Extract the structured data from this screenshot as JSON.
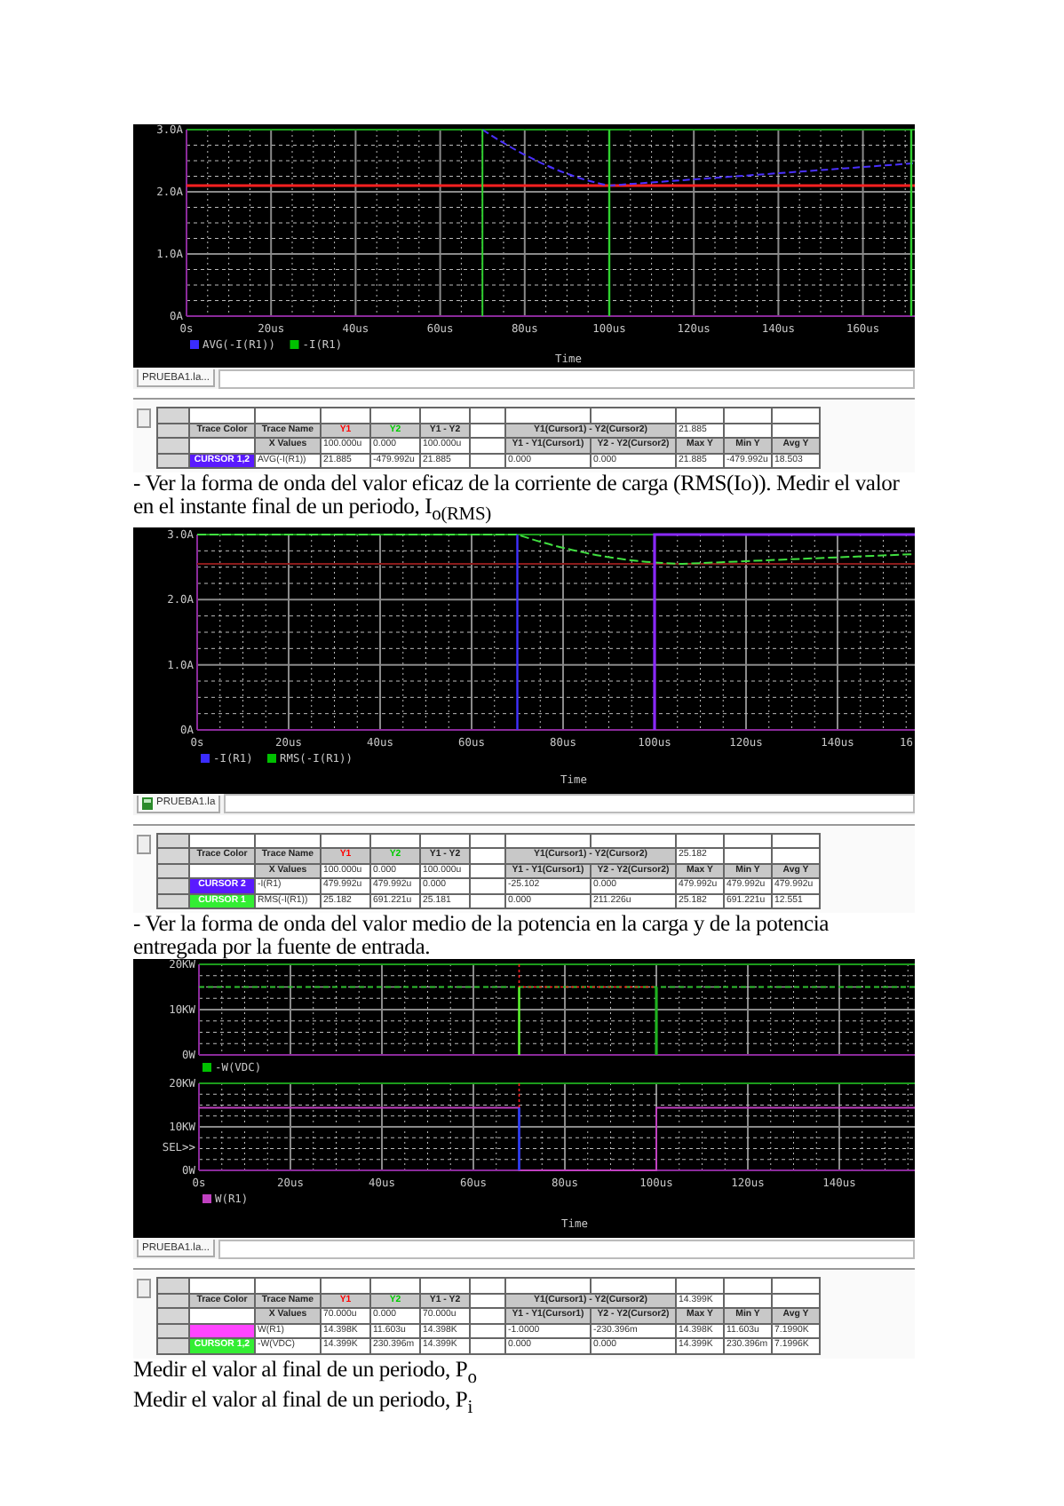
{
  "sections": [
    {
      "plot": {
        "panels": [
          {
            "yticks": [
              "3.0A",
              "2.0A",
              "1.0A",
              "0A"
            ],
            "legend": [
              {
                "label": "AVG(-I(R1))",
                "color": "#3a2cff"
              },
              {
                "label": "-I(R1)",
                "color": "#00c000"
              }
            ]
          }
        ],
        "xticks": [
          "0s",
          "20us",
          "40us",
          "60us",
          "80us",
          "100us",
          "120us",
          "140us",
          "160us"
        ],
        "xlabel": "Time"
      },
      "probe": {
        "tab": "PRUEBA1.la...",
        "has_icon": false,
        "table": {
          "columns": [
            {
              "label": "Trace Color"
            },
            {
              "label": "Trace Name"
            },
            {
              "label": "Y1",
              "color": "#ff0000"
            },
            {
              "label": "Y2",
              "color": "#00cc00"
            },
            {
              "label": "Y1 - Y2"
            }
          ],
          "cursor_delta_label": "Y1(Cursor1) - Y2(Cursor2)",
          "cursor_delta": "21.885",
          "x_values": {
            "label": "X Values",
            "values": [
              "100.000u",
              "0.000",
              "100.000u"
            ]
          },
          "stat_columns": [
            "Y1 - Y1(Cursor1)",
            "Y2 - Y2(Cursor2)",
            "Max Y",
            "Min Y",
            "Avg Y"
          ],
          "rows": [
            {
              "cursor": "CURSOR 1,2",
              "color": "#5a1aff",
              "name": "AVG(-I(R1))",
              "values": [
                "21.885",
                "-479.992u",
                "21.885"
              ],
              "stats": [
                "0.000",
                "0.000",
                "21.885",
                "-479.992u",
                "18.503"
              ]
            }
          ]
        }
      },
      "paragraph": "- Ver la forma de onda del valor eficaz de la corriente de carga (RMS(Io)). Medir el valor en el instante final de un periodo, I$_{o(RMS)}$"
    },
    {
      "plot": {
        "panels": [
          {
            "yticks": [
              "3.0A",
              "2.0A",
              "1.0A",
              "0A"
            ],
            "legend": [
              {
                "label": "-I(R1)",
                "color": "#3a2cff"
              },
              {
                "label": "RMS(-I(R1))",
                "color": "#00c000"
              }
            ]
          }
        ],
        "xticks": [
          "0s",
          "20us",
          "40us",
          "60us",
          "80us",
          "100us",
          "120us",
          "140us",
          "16"
        ],
        "xlabel": "Time"
      },
      "probe": {
        "tab": "PRUEBA1.la",
        "has_icon": true,
        "table": {
          "columns": [
            {
              "label": "Trace Color"
            },
            {
              "label": "Trace Name"
            },
            {
              "label": "Y1",
              "color": "#ff0000"
            },
            {
              "label": "Y2",
              "color": "#00cc00"
            },
            {
              "label": "Y1 - Y2"
            }
          ],
          "cursor_delta_label": "Y1(Cursor1) - Y2(Cursor2)",
          "cursor_delta": "25.182",
          "x_values": {
            "label": "X Values",
            "values": [
              "100.000u",
              "0.000",
              "100.000u"
            ]
          },
          "stat_columns": [
            "Y1 - Y1(Cursor1)",
            "Y2 - Y2(Cursor2)",
            "Max Y",
            "Min Y",
            "Avg Y"
          ],
          "rows": [
            {
              "cursor": "CURSOR 2",
              "color": "#5a1aff",
              "name": "-I(R1)",
              "values": [
                "479.992u",
                "479.992u",
                "0.000"
              ],
              "stats": [
                "-25.102",
                "0.000",
                "479.992u",
                "479.992u",
                "479.992u"
              ]
            },
            {
              "cursor": "CURSOR 1",
              "color": "#33ee33",
              "name": "RMS(-I(R1))",
              "values": [
                "25.182",
                "691.221u",
                "25.181"
              ],
              "stats": [
                "0.000",
                "211.226u",
                "25.182",
                "691.221u",
                "12.551"
              ]
            }
          ]
        }
      },
      "paragraph": "- Ver la forma de onda del valor medio de la potencia en la carga y de la potencia entregada por la fuente de entrada."
    },
    {
      "plot": {
        "panels": [
          {
            "yticks": [
              "20KW",
              "10KW",
              "0W"
            ],
            "legend": [
              {
                "label": "-W(VDC)",
                "color": "#00c000"
              }
            ]
          },
          {
            "yticks": [
              "20KW",
              "10KW",
              "0W"
            ],
            "side_label": "SEL>>",
            "legend": [
              {
                "label": "W(R1)",
                "color": "#c040c0"
              }
            ]
          }
        ],
        "xticks": [
          "0s",
          "20us",
          "40us",
          "60us",
          "80us",
          "100us",
          "120us",
          "140us"
        ],
        "xlabel": "Time"
      },
      "probe": {
        "tab": "PRUEBA1.la...",
        "has_icon": false,
        "table": {
          "columns": [
            {
              "label": "Trace Color"
            },
            {
              "label": "Trace Name"
            },
            {
              "label": "Y1",
              "color": "#ff0000"
            },
            {
              "label": "Y2",
              "color": "#00cc00"
            },
            {
              "label": "Y1 - Y2"
            }
          ],
          "cursor_delta_label": "Y1(Cursor1) - Y2(Cursor2)",
          "cursor_delta": "14.399K",
          "x_values": {
            "label": "X Values",
            "values": [
              "70.000u",
              "0.000",
              "70.000u"
            ]
          },
          "stat_columns": [
            "Y1 - Y1(Cursor1)",
            "Y2 - Y2(Cursor2)",
            "Max Y",
            "Min Y",
            "Avg Y"
          ],
          "rows": [
            {
              "color": "#ff44ff",
              "name": "W(R1)",
              "values": [
                "14.398K",
                "11.603u",
                "14.398K"
              ],
              "stats": [
                "-1.0000",
                "-230.396m",
                "14.398K",
                "11.603u",
                "7.1990K"
              ]
            },
            {
              "cursor": "CURSOR 1,2",
              "color": "#33ee33",
              "name": "-W(VDC)",
              "values": [
                "14.399K",
                "230.396m",
                "14.399K"
              ],
              "stats": [
                "0.000",
                "0.000",
                "14.399K",
                "230.396m",
                "7.1996K"
              ]
            }
          ]
        }
      }
    }
  ],
  "notes": [
    "Medir el valor al final de un periodo, P$_{o}$",
    "Medir el valor al final de un periodo, P$_{i}$"
  ]
}
